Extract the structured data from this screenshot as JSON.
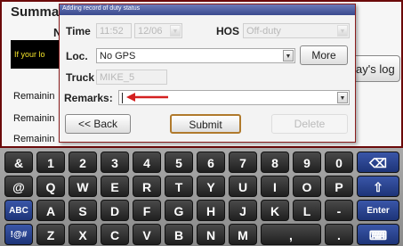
{
  "background": {
    "title": "Summa",
    "subtitle_fragment": "N",
    "banner_text": "If your lo",
    "remaining_labels": [
      "Remainin",
      "Remainin",
      "Remainin"
    ],
    "day_log_button": "ay's log"
  },
  "dialog": {
    "title": "Adding record of duty status",
    "time_label": "Time",
    "time_value": "11:52",
    "date_value": "12/06",
    "hos_label": "HOS",
    "hos_value": "Off-duty",
    "loc_label": "Loc.",
    "loc_value": "No GPS",
    "more_button": "More",
    "truck_label": "Truck",
    "truck_value": "MIKE_5",
    "remarks_label": "Remarks:",
    "remarks_value": "",
    "back_button": "<< Back",
    "submit_button": "Submit",
    "delete_button": "Delete"
  },
  "keyboard": {
    "row1": [
      "&",
      "1",
      "2",
      "3",
      "4",
      "5",
      "6",
      "7",
      "8",
      "9",
      "0",
      "⌫"
    ],
    "row2": [
      "@",
      "Q",
      "W",
      "E",
      "R",
      "T",
      "Y",
      "U",
      "I",
      "O",
      "P",
      "⇧"
    ],
    "row3": [
      "ABC",
      "A",
      "S",
      "D",
      "F",
      "G",
      "H",
      "J",
      "K",
      "L",
      "-",
      "Enter"
    ],
    "row4": [
      "!@#",
      "Z",
      "X",
      "C",
      "V",
      "B",
      "N",
      "M",
      ",",
      ".",
      "⌨"
    ]
  },
  "colors": {
    "dialog_border": "#8b1d1d",
    "banner_text": "#f2e22a",
    "arrow": "#d42020",
    "function_key": "#2a44a0"
  }
}
